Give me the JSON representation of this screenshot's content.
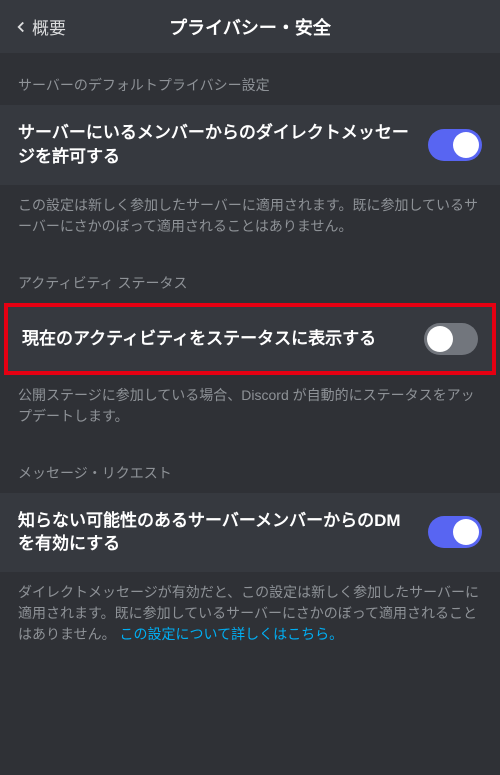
{
  "header": {
    "back_label": "概要",
    "title": "プライバシー・安全"
  },
  "sections": {
    "server_default": {
      "header": "サーバーのデフォルトプライバシー設定",
      "item": {
        "label": "サーバーにいるメンバーからのダイレクトメッセージを許可する",
        "description": "この設定は新しく参加したサーバーに適用されます。既に参加しているサーバーにさかのぼって適用されることはありません。",
        "toggle_on": true
      }
    },
    "activity_status": {
      "header": "アクティビティ ステータス",
      "item": {
        "label": "現在のアクティビティをステータスに表示する",
        "description": "公開ステージに参加している場合、Discord が自動的にステータスをアップデートします。",
        "toggle_on": false
      }
    },
    "message_request": {
      "header": "メッセージ・リクエスト",
      "item": {
        "label": "知らない可能性のあるサーバーメンバーからのDMを有効にする",
        "description": "ダイレクトメッセージが有効だと、この設定は新しく参加したサーバーに適用されます。既に参加しているサーバーにさかのぼって適用されることはありません。",
        "link": "この設定について詳しくはこちら。",
        "toggle_on": true
      }
    }
  }
}
